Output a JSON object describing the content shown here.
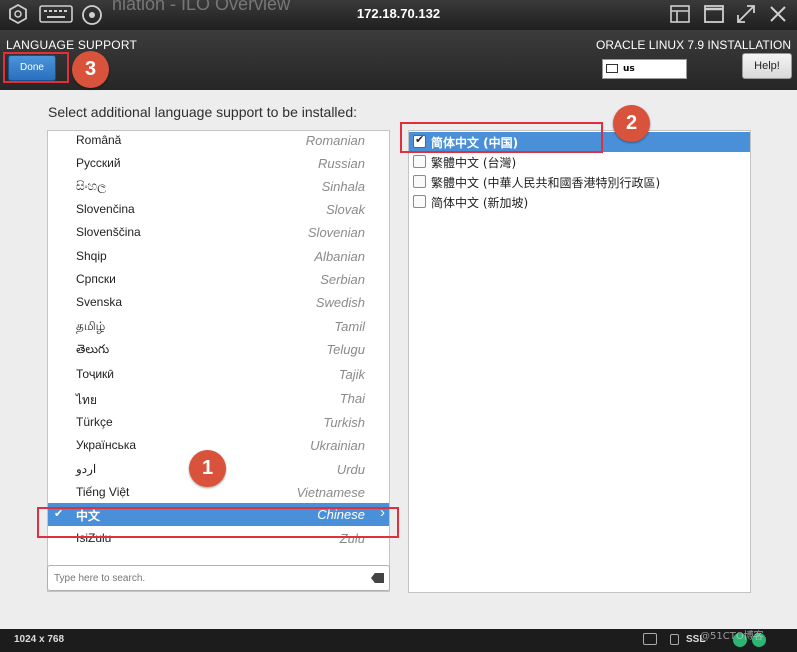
{
  "window": {
    "title": "172.18.70.132",
    "ghost_title": "nlation - ILO Overview",
    "icons": [
      "hexagon-logo-icon",
      "keyboard-icon",
      "settings-circle-icon",
      "layout-icon",
      "maximize-icon",
      "fullscreen-icon",
      "close-icon"
    ]
  },
  "header": {
    "title": "LANGUAGE SUPPORT",
    "product": "ORACLE LINUX 7.9 INSTALLATION",
    "done_label": "Done",
    "keyboard_layout": "us",
    "help_label": "Help!"
  },
  "main": {
    "prompt": "Select additional language support to be installed:",
    "languages": [
      {
        "native": "Română",
        "english": "Romanian"
      },
      {
        "native": "Русский",
        "english": "Russian"
      },
      {
        "native": "සිංහල",
        "english": "Sinhala"
      },
      {
        "native": "Slovenčina",
        "english": "Slovak"
      },
      {
        "native": "Slovenščina",
        "english": "Slovenian"
      },
      {
        "native": "Shqip",
        "english": "Albanian"
      },
      {
        "native": "Српски",
        "english": "Serbian"
      },
      {
        "native": "Svenska",
        "english": "Swedish"
      },
      {
        "native": "தமிழ்",
        "english": "Tamil"
      },
      {
        "native": "తెలుగు",
        "english": "Telugu"
      },
      {
        "native": "Тоҷикӣ",
        "english": "Tajik"
      },
      {
        "native": "ไทย",
        "english": "Thai"
      },
      {
        "native": "Türkçe",
        "english": "Turkish"
      },
      {
        "native": "Українська",
        "english": "Ukrainian"
      },
      {
        "native": "اردو",
        "english": "Urdu"
      },
      {
        "native": "Tiếng Việt",
        "english": "Vietnamese"
      },
      {
        "native": "中文",
        "english": "Chinese",
        "selected": true
      },
      {
        "native": "IsiZulu",
        "english": "Zulu"
      }
    ],
    "search_placeholder": "Type here to search.",
    "locales": [
      {
        "label": "简体中文 (中国)",
        "checked": true
      },
      {
        "label": "繁體中文 (台灣)",
        "checked": false
      },
      {
        "label": "繁體中文 (中華人民共和國香港特別行政區)",
        "checked": false
      },
      {
        "label": "简体中文 (新加坡)",
        "checked": false
      }
    ]
  },
  "annotations": {
    "step1": "1",
    "step2": "2",
    "step3": "3",
    "accent": "#e0303c",
    "badge_color": "#d9523b"
  },
  "statusbar": {
    "resolution": "1024 x 768",
    "ssl": "SSL",
    "watermark": "@51CTO博客"
  },
  "colors": {
    "selection": "#4a90d9",
    "done_button": "#2a6fbe"
  }
}
